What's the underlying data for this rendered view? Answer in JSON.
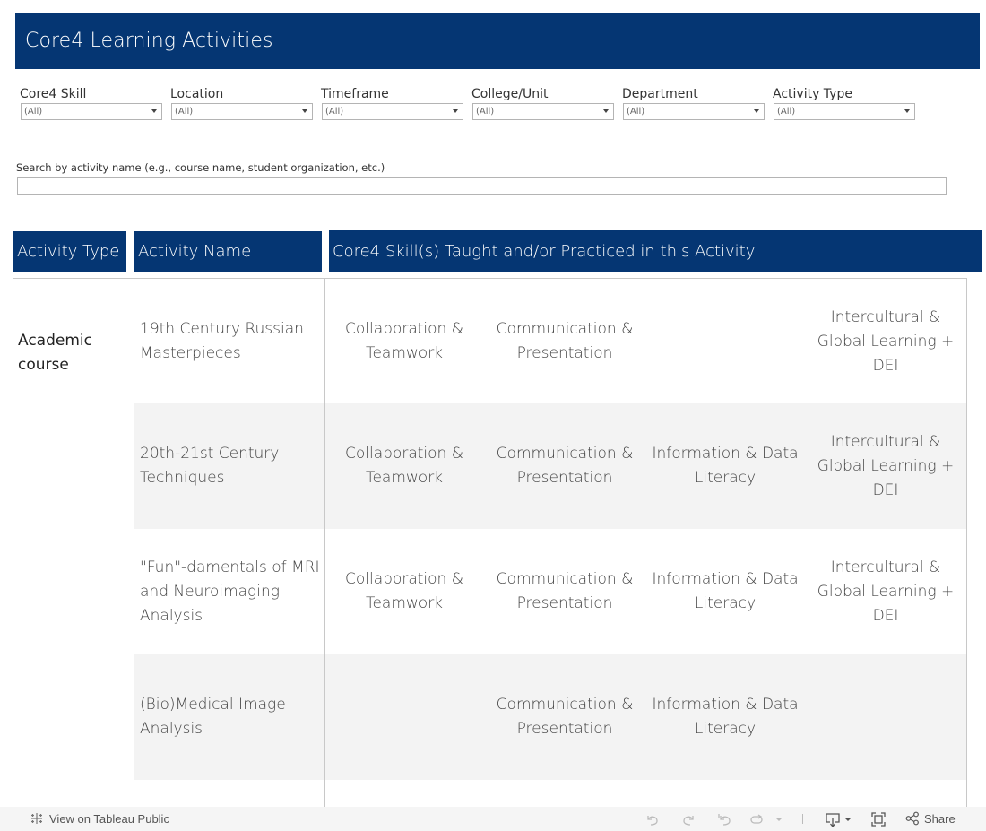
{
  "header": {
    "title": "Core4 Learning Activities"
  },
  "filters": [
    {
      "label": "Core4 Skill",
      "value": "(All)"
    },
    {
      "label": "Location",
      "value": "(All)"
    },
    {
      "label": "Timeframe",
      "value": "(All)"
    },
    {
      "label": "College/Unit",
      "value": "(All)"
    },
    {
      "label": "Department",
      "value": "(All)"
    },
    {
      "label": "Activity Type",
      "value": "(All)"
    }
  ],
  "search": {
    "label": "Search by activity name (e.g., course name, student organization, etc.)",
    "value": "",
    "placeholder": ""
  },
  "table": {
    "headers": {
      "activity_type": "Activity Type",
      "activity_name": "Activity Name",
      "skills": "Core4 Skill(s) Taught and/or Practiced in this Activity"
    },
    "activity_type_value": "Academic course",
    "rows": [
      {
        "name": "19th Century Russian Masterpieces",
        "skills": [
          "Collaboration & Teamwork",
          "Communication & Presentation",
          "",
          "Intercultural & Global Learning + DEI"
        ]
      },
      {
        "name": "20th-21st Century Techniques",
        "skills": [
          "Collaboration & Teamwork",
          "Communication & Presentation",
          "Information & Data Literacy",
          "Intercultural & Global Learning + DEI"
        ]
      },
      {
        "name": "\"Fun\"-damentals of MRI and Neuroimaging Analysis",
        "skills": [
          "Collaboration & Teamwork",
          "Communication & Presentation",
          "Information & Data Literacy",
          "Intercultural & Global Learning + DEI"
        ]
      },
      {
        "name": "(Bio)Medical Image Analysis",
        "skills": [
          "",
          "Communication & Presentation",
          "Information & Data Literacy",
          ""
        ]
      }
    ]
  },
  "footer": {
    "view_link": "View on Tableau Public",
    "share_label": "Share",
    "icons": [
      "tableau-logo-icon",
      "undo-icon",
      "redo-icon",
      "revert-icon",
      "refresh-icon",
      "pause-dropdown-icon",
      "download-icon",
      "fullscreen-icon",
      "share-icon"
    ]
  },
  "colors": {
    "header_bg": "#053673",
    "alt_row_bg": "#f3f3f3",
    "footer_bg": "#f5f5f5"
  }
}
